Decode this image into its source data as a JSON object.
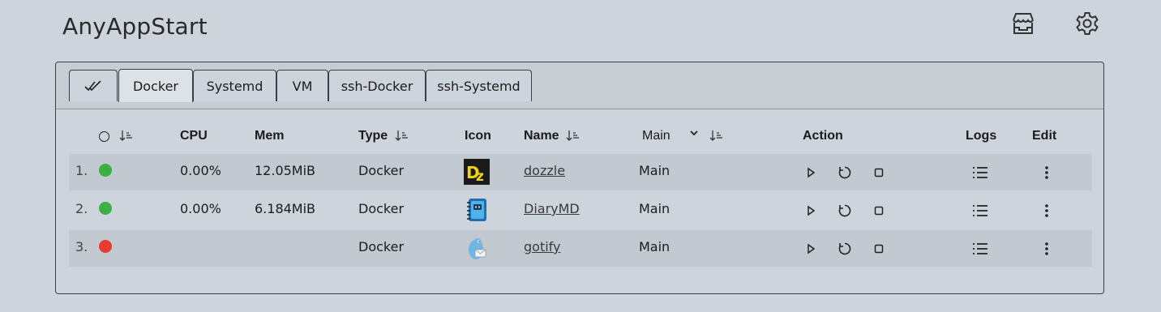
{
  "app": {
    "title": "AnyAppStart"
  },
  "header_icons": [
    "app-store-icon",
    "gear-icon"
  ],
  "tabs": [
    {
      "label": "",
      "icon": "double-check-icon"
    },
    {
      "label": "Docker",
      "active": true
    },
    {
      "label": "Systemd"
    },
    {
      "label": "VM"
    },
    {
      "label": "ssh-Docker"
    },
    {
      "label": "ssh-Systemd"
    }
  ],
  "columns": {
    "cpu": "CPU",
    "mem": "Mem",
    "type": "Type",
    "icon": "Icon",
    "name": "Name",
    "group_select": "Main",
    "action": "Action",
    "logs": "Logs",
    "edit": "Edit"
  },
  "rows": [
    {
      "index": "1.",
      "status": "running",
      "status_color": "#3cb043",
      "cpu": "0.00%",
      "mem": "12.05MiB",
      "type": "Docker",
      "icon": "dozzle-logo",
      "name": "dozzle",
      "group": "Main"
    },
    {
      "index": "2.",
      "status": "running",
      "status_color": "#3cb043",
      "cpu": "0.00%",
      "mem": "6.184MiB",
      "type": "Docker",
      "icon": "diarymd-notebook-logo",
      "name": "DiaryMD",
      "group": "Main"
    },
    {
      "index": "3.",
      "status": "stopped",
      "status_color": "#e53b30",
      "cpu": "",
      "mem": "",
      "type": "Docker",
      "icon": "gotify-bird-logo",
      "name": "gotify",
      "group": "Main"
    }
  ],
  "colors": {
    "background": "#ced4db",
    "row_alt": "#c2c9d0",
    "running": "#3cb043",
    "stopped": "#e53b30"
  }
}
